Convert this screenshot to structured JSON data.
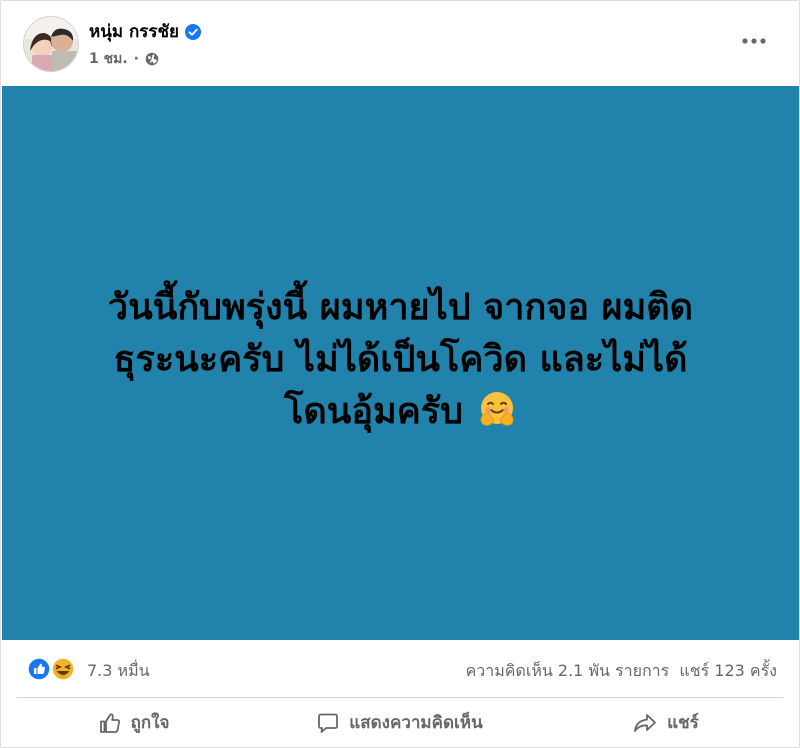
{
  "post": {
    "author": "หนุ่ม กรรชัย",
    "timestamp": "1 ชม.",
    "separator": "·",
    "status_line1": "วันนี้กับพรุ่งนี้ ผมหายไป จากจอ ผมติด",
    "status_line2": "ธุระนะครับ ไม่ได้เป็นโควิด และไม่ได้",
    "status_line3": "โดนอุ้มครับ",
    "background_color": "#2183ab"
  },
  "reactions": {
    "count": "7.3 หมื่น",
    "types": [
      "like-icon",
      "haha-icon"
    ],
    "comments_shares": "ความคิดเห็น 2.1 พัน รายการ  แชร์ 123 ครั้ง"
  },
  "actions": {
    "like_label": "ถูกใจ",
    "comment_label": "แสดงความคิดเห็น",
    "share_label": "แชร์"
  },
  "colors": {
    "verified": "#1877f2",
    "like": "#1877f2",
    "haha": "#f7b125",
    "muted_text": "#65676b"
  }
}
